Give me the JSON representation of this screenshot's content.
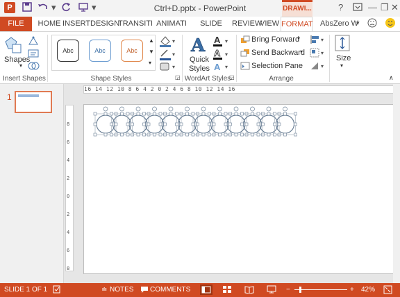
{
  "titlebar": {
    "title": "Ctrl+D.pptx - PowerPoint",
    "app_icon": "P",
    "drawing_tools": "DRAWI...",
    "help": "?",
    "minimize": "—",
    "restore": "❐",
    "close": "✕"
  },
  "tabs": {
    "file": "FILE",
    "items": [
      "HOME",
      "INSERT",
      "DESIGN",
      "TRANSITI",
      "ANIMATI",
      "SLIDE SHO",
      "REVIEW",
      "VIEW",
      "FORMAT"
    ],
    "active": "FORMAT",
    "user": "AbsZero W"
  },
  "ribbon": {
    "insert_shapes": {
      "label": "Insert Shapes",
      "shapes_label": "Shapes"
    },
    "shape_styles": {
      "label": "Shape Styles",
      "styles": [
        "Abc",
        "Abc",
        "Abc"
      ]
    },
    "wordart_styles": {
      "label": "WordArt Styles",
      "quick_styles": "Quick Styles",
      "quick_line1": "Quick",
      "quick_line2": "Styles"
    },
    "arrange": {
      "label": "Arrange",
      "bring_forward": "Bring Forward",
      "send_backward": "Send Backward",
      "selection_pane": "Selection Pane"
    },
    "size": {
      "label": "Size"
    }
  },
  "thumbnails": {
    "number": "1"
  },
  "ruler": {
    "horizontal": "16 14 12 10 8 6 4 2 0 2 4 6 8 10 12 14 16",
    "vertical": [
      "8",
      "6",
      "4",
      "2",
      "0",
      "2",
      "4",
      "6",
      "8"
    ]
  },
  "status": {
    "slide": "SLIDE 1 OF 1",
    "notes": "NOTES",
    "comments": "COMMENTS",
    "zoom": "42%"
  },
  "colors": {
    "accent": "#d04a22",
    "status_bar": "#d04a22"
  }
}
